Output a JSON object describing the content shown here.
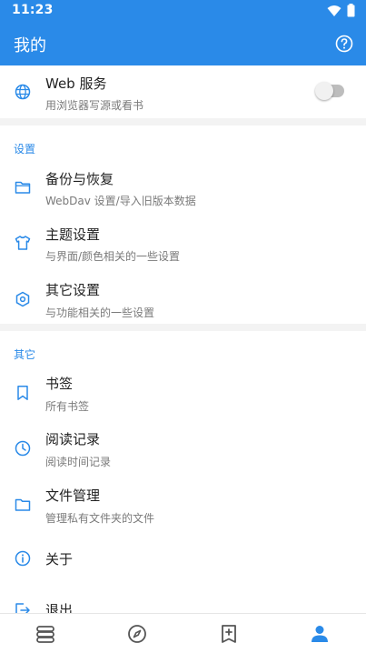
{
  "status_bar": {
    "time": "11:23"
  },
  "app_bar": {
    "title": "我的"
  },
  "web_service": {
    "title": "Web 服务",
    "subtitle": "用浏览器写源或看书",
    "enabled": false
  },
  "settings_section": {
    "label": "设置",
    "items": [
      {
        "title": "备份与恢复",
        "subtitle": "WebDav 设置/导入旧版本数据"
      },
      {
        "title": "主题设置",
        "subtitle": "与界面/颜色相关的一些设置"
      },
      {
        "title": "其它设置",
        "subtitle": "与功能相关的一些设置"
      }
    ]
  },
  "other_section": {
    "label": "其它",
    "items": [
      {
        "title": "书签",
        "subtitle": "所有书签"
      },
      {
        "title": "阅读记录",
        "subtitle": "阅读时间记录"
      },
      {
        "title": "文件管理",
        "subtitle": "管理私有文件夹的文件"
      },
      {
        "title": "关于"
      },
      {
        "title": "退出"
      }
    ]
  },
  "colors": {
    "primary": "#2a8ae8",
    "subtitle": "#7a7a7a",
    "icon": "#2a8ae8",
    "nav_inactive": "#555555"
  }
}
